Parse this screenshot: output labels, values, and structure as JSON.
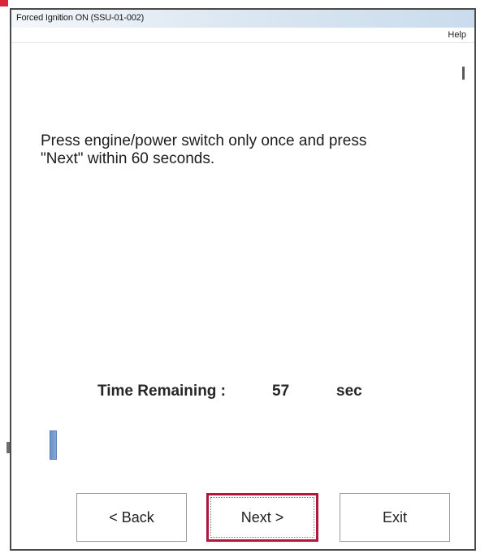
{
  "window": {
    "title": "Forced Ignition ON (SSU-01-002)"
  },
  "menu": {
    "help": "Help"
  },
  "instruction": {
    "text": "Press engine/power switch only once and press\n\"Next\" within 60 seconds."
  },
  "timer": {
    "label": "Time Remaining :",
    "value": "57",
    "unit": "sec"
  },
  "progress": {
    "fraction": 0.018
  },
  "buttons": {
    "back": "< Back",
    "next": "Next >",
    "exit": "Exit"
  },
  "colors": {
    "accent_focus_border": "#b0173a",
    "progress_fill": "#7a9ccf"
  }
}
